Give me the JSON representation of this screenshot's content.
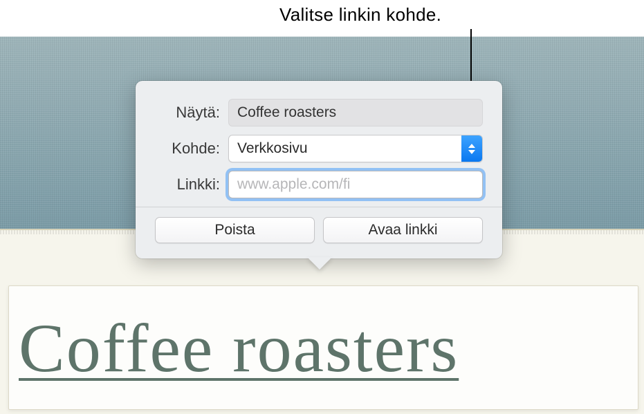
{
  "callout": {
    "text": "Valitse linkin kohde."
  },
  "popover": {
    "display_label": "Näytä:",
    "display_value": "Coffee roasters",
    "target_label": "Kohde:",
    "target_value": "Verkkosivu",
    "link_label": "Linkki:",
    "link_placeholder": "www.apple.com/fi",
    "remove_button": "Poista",
    "open_button": "Avaa linkki"
  },
  "document": {
    "link_text": "Coffee roasters"
  }
}
